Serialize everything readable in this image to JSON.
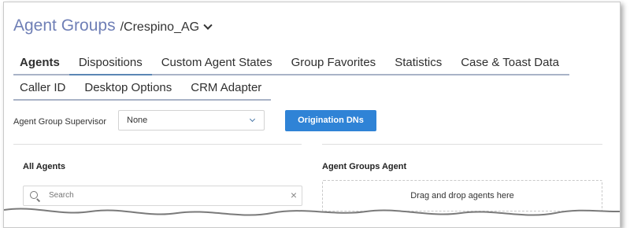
{
  "header": {
    "title": "Agent Groups",
    "subtitle": "/Crespino_AG"
  },
  "tabs_row1": [
    "Agents",
    "Dispositions",
    "Custom Agent States",
    "Group Favorites",
    "Statistics",
    "Case & Toast Data"
  ],
  "tabs_row2": [
    "Caller ID",
    "Desktop Options",
    "CRM Adapter"
  ],
  "supervisor": {
    "label": "Agent Group Supervisor",
    "value": "None"
  },
  "origination_button": "Origination DNs",
  "left_panel": {
    "title": "All Agents",
    "search_placeholder": "Search"
  },
  "right_panel": {
    "title": "Agent Groups Agent",
    "drop_text": "Drag and drop agents here"
  },
  "colors": {
    "title": "#6f7fb6",
    "button": "#2f83d6",
    "tab_underline": "#a9b3c7"
  }
}
